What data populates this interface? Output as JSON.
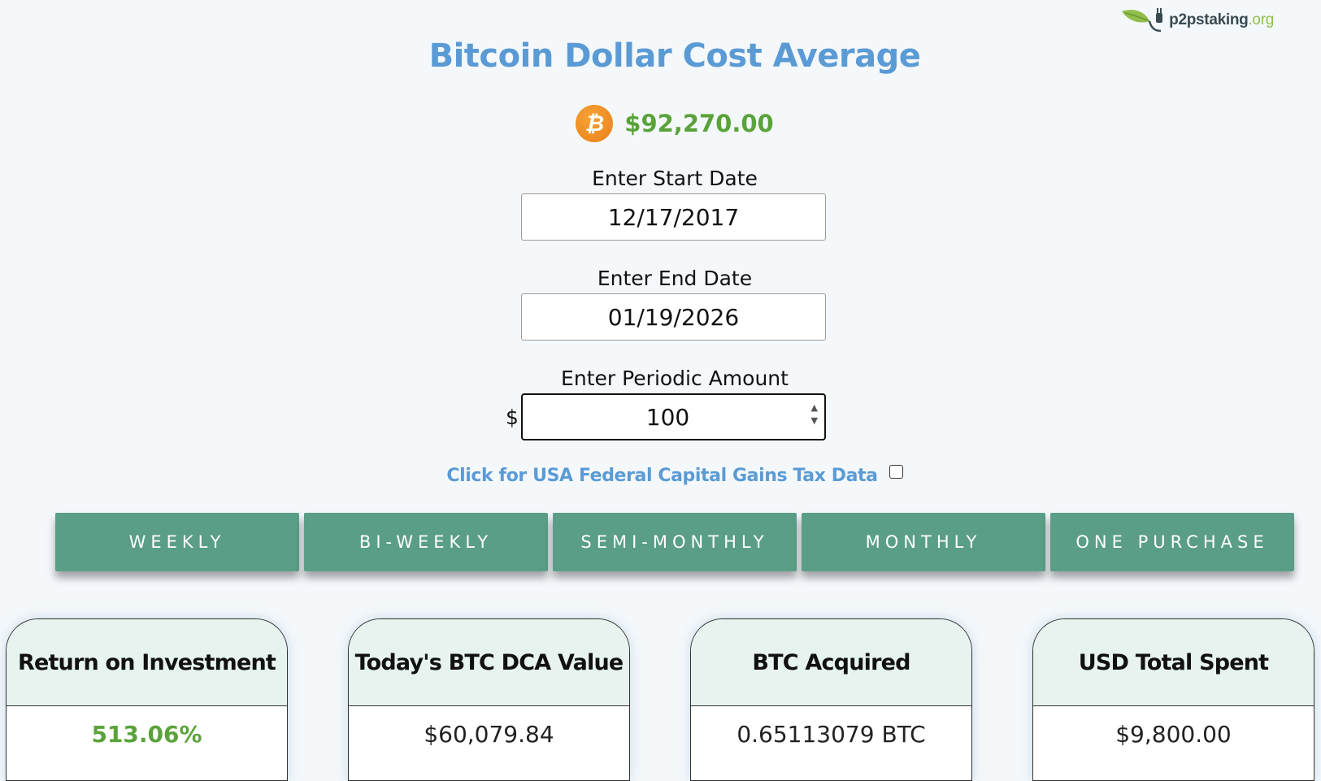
{
  "brand": {
    "name": "p2pstaking",
    "tld": ".org",
    "icon": "leaf-plug-icon"
  },
  "title": "Bitcoin Dollar Cost Average",
  "price": {
    "icon": "bitcoin-icon",
    "glyph": "₿",
    "value": "$92,270.00",
    "color": "#5aa33a"
  },
  "start_date": {
    "label": "Enter Start Date",
    "value": "12/17/2017"
  },
  "end_date": {
    "label": "Enter End Date",
    "value": "01/19/2026"
  },
  "amount": {
    "label": "Enter Periodic Amount",
    "currency": "$",
    "value": "100"
  },
  "tax": {
    "label": "Click for USA Federal Capital Gains Tax Data",
    "checked": false
  },
  "frequency_buttons": [
    {
      "label": "WEEKLY"
    },
    {
      "label": "BI-WEEKLY"
    },
    {
      "label": "SEMI-MONTHLY"
    },
    {
      "label": "MONTHLY"
    },
    {
      "label": "ONE PURCHASE"
    }
  ],
  "results": [
    {
      "title": "Return on Investment",
      "value": "513.06%"
    },
    {
      "title": "Today's BTC DCA Value",
      "value": "$60,079.84"
    },
    {
      "title": "BTC Acquired",
      "value": "0.65113079 BTC"
    },
    {
      "title": "USD Total Spent",
      "value": "$9,800.00"
    }
  ],
  "colors": {
    "accent_blue": "#5b9bd5",
    "button_green": "#5a9e87",
    "positive_green": "#5aa33a",
    "bitcoin_orange": "#f2921f"
  }
}
